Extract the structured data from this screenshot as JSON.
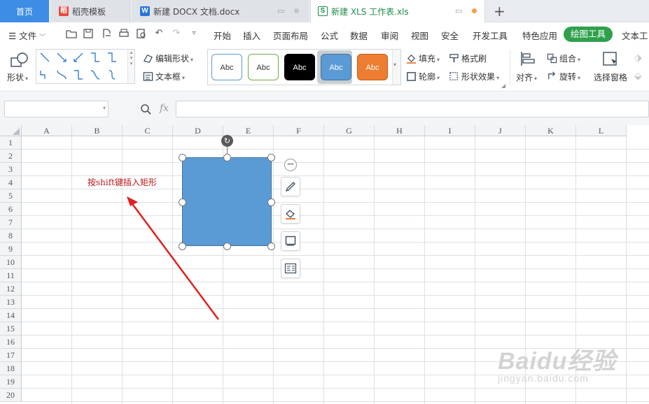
{
  "tabs": [
    {
      "label": "首页",
      "active": false
    },
    {
      "label": "稻壳模板",
      "active": false
    },
    {
      "label": "新建 DOCX 文档.docx",
      "active": false
    },
    {
      "label": "新建 XLS 工作表.xls",
      "active": true
    }
  ],
  "new_tab_symbol": "+",
  "menubar": {
    "file_label": "文件",
    "items": [
      "开始",
      "插入",
      "页面布局",
      "公式",
      "数据",
      "审阅",
      "视图",
      "安全",
      "开发工具",
      "特色应用"
    ],
    "active_item": "绘图工具",
    "overflow_item": "文本工"
  },
  "ribbon": {
    "shape_label": "形状",
    "edit_shape_label": "编辑形状",
    "textbox_label": "文本框",
    "style_samples": [
      {
        "label": "Abc",
        "fill": "#ffffff",
        "border": "#5b9bd5",
        "text": "#333333"
      },
      {
        "label": "Abc",
        "fill": "#ffffff",
        "border": "#70ad47",
        "text": "#333333"
      },
      {
        "label": "Abc",
        "fill": "#000000",
        "border": "#000000",
        "text": "#ffffff"
      },
      {
        "label": "Abc",
        "fill": "#5b9bd5",
        "border": "#41719c",
        "text": "#ffffff"
      },
      {
        "label": "Abc",
        "fill": "#ed7d31",
        "border": "#c55a11",
        "text": "#ffffff"
      }
    ],
    "fill_label": "填充",
    "format_painter_label": "格式刷",
    "outline_label": "轮廓",
    "shape_effects_label": "形状效果",
    "align_label": "对齐",
    "group_label": "组合",
    "rotate_label": "旋转",
    "selection_pane_label": "选择窗格"
  },
  "formula_bar": {
    "name_box_value": "",
    "fx_label": "fx",
    "formula_value": ""
  },
  "sheet": {
    "columns": [
      "A",
      "B",
      "C",
      "D",
      "E",
      "F",
      "G",
      "H",
      "I",
      "J",
      "K",
      "L"
    ],
    "rows": [
      "1",
      "2",
      "3",
      "4",
      "5",
      "6",
      "7",
      "8",
      "9",
      "10",
      "11",
      "12",
      "13",
      "14",
      "15",
      "16",
      "17",
      "18",
      "19",
      "20"
    ],
    "annotation_text": "按shift键插入矩形",
    "shape_fill": "#5b9bd5",
    "arrow_color": "#e02020"
  },
  "watermark": {
    "brand": "Baidu经验",
    "url": "jingyan.baidu.com"
  },
  "colors": {
    "accent_green": "#2fa04c",
    "home_tab_blue": "#3d8de4"
  }
}
